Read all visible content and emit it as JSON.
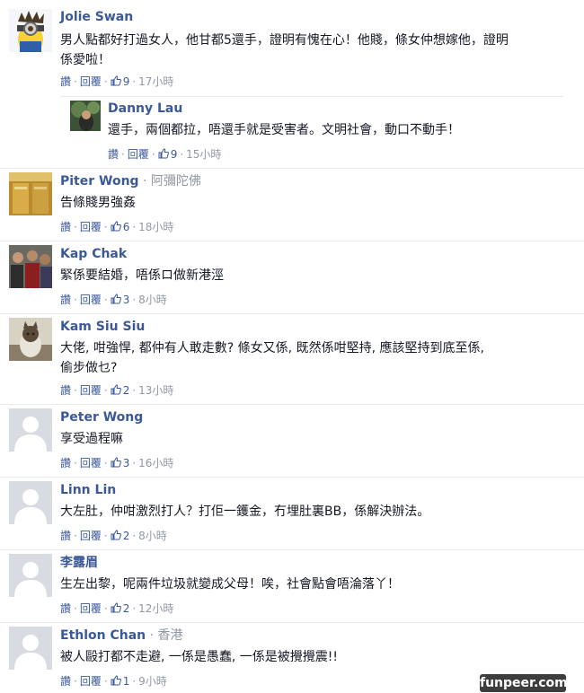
{
  "labels": {
    "like": "讚",
    "reply": "回覆"
  },
  "comments": [
    {
      "name": "Jolie Swan",
      "via": "",
      "text": "男人點都好打過女人，他甘都5還手，證明有愧在心！他賤，條女仲想嫁他，證明係愛啦！",
      "likes": "9",
      "time": "17小時"
    },
    {
      "name": "Danny Lau",
      "via": "",
      "text": "還手，兩個都拉，唔還手就是受害者。文明社會，動口不動手！",
      "likes": "9",
      "time": "15小時"
    },
    {
      "name": "Piter Wong",
      "via": "· 阿彌陀佛",
      "text": "告條賤男強姦",
      "likes": "6",
      "time": "18小時"
    },
    {
      "name": "Kap Chak",
      "via": "",
      "text": "緊係要結婚，唔係ロ做新港涇",
      "likes": "3",
      "time": "8小時"
    },
    {
      "name": "Kam Siu Siu",
      "via": "",
      "text": "大佬, 咁強悍, 都仲有人敢走數? 條女又係, 既然係咁堅持, 應該堅持到底至係, 偷步做乜?",
      "likes": "2",
      "time": "13小時"
    },
    {
      "name": "Peter Wong",
      "via": "",
      "text": "享受過程嘛",
      "likes": "3",
      "time": "16小時"
    },
    {
      "name": "Linn Lin",
      "via": "",
      "text": "大左肚，仲咁激烈打人？打佢一鑊金，冇埋肚裏BB，係解決辦法。",
      "likes": "2",
      "time": "8小時"
    },
    {
      "name": "李露眉",
      "via": "",
      "text": "生左出黎，呢兩件垃圾就變成父母！唉，社會點會唔淪落丫！",
      "likes": "2",
      "time": "12小時"
    },
    {
      "name": "Ethlon Chan",
      "via": "· 香港",
      "text": "被人毆打都不走避, 一係是愚蠢, 一係是被攪攪震!!",
      "likes": "1",
      "time": "9小時"
    }
  ],
  "watermark": "funpeer.com"
}
